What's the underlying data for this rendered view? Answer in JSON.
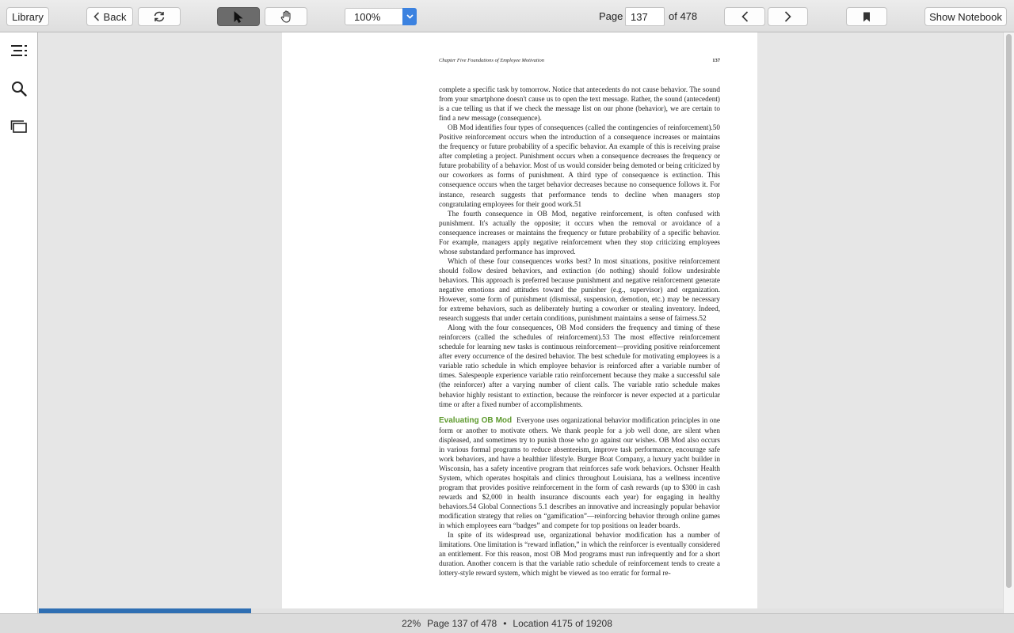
{
  "toolbar": {
    "library": "Library",
    "back": "Back",
    "zoom": "100%",
    "page_prefix": "Page",
    "page_value": "137",
    "page_suffix": "of 478",
    "show_notebook": "Show Notebook"
  },
  "book": {
    "running_head": "Chapter Five   Foundations of Employee Motivation",
    "page_number": "137",
    "section_heading": "Evaluating OB Mod",
    "paragraphs": [
      "complete a specific task by tomorrow. Notice that antecedents do not cause behavior. The sound from your smartphone doesn't cause us to open the text message. Rather, the sound (antecedent) is a cue telling us that if we check the message list on our phone (behavior), we are certain to find a new message (consequence).",
      "OB Mod identifies four types of consequences (called the contingencies of reinforcement).50 Positive reinforcement occurs when the introduction of a consequence increases or maintains the frequency or future probability of a specific behavior. An example of this is receiving praise after completing a project. Punishment occurs when a consequence decreases the frequency or future probability of a behavior. Most of us would consider being demoted or being criticized by our coworkers as forms of punishment. A third type of consequence is extinction. This consequence occurs when the target behavior decreases because no consequence follows it. For instance, research suggests that performance tends to decline when managers stop congratulating employees for their good work.51",
      "The fourth consequence in OB Mod, negative reinforcement, is often confused with punishment. It's actually the opposite; it occurs when the removal or avoidance of a consequence increases or maintains the frequency or future probability of a specific behavior. For example, managers apply negative reinforcement when they stop criticizing employees whose substandard performance has improved.",
      "Which of these four consequences works best? In most situations, positive reinforcement should follow desired behaviors, and extinction (do nothing) should follow undesirable behaviors. This approach is preferred because punishment and negative reinforcement generate negative emotions and attitudes toward the punisher (e.g., supervisor) and organization. However, some form of punishment (dismissal, suspension, demotion, etc.) may be necessary for extreme behaviors, such as deliberately hurting a coworker or stealing inventory. Indeed, research suggests that under certain conditions, punishment maintains a sense of fairness.52",
      "Along with the four consequences, OB Mod considers the frequency and timing of these reinforcers (called the schedules of reinforcement).53 The most effective reinforcement schedule for learning new tasks is continuous reinforcement—providing positive reinforcement after every occurrence of the desired behavior. The best schedule for motivating employees is a variable ratio schedule in which employee behavior is reinforced after a variable number of times. Salespeople experience variable ratio reinforcement because they make a successful sale (the reinforcer) after a varying number of client calls. The variable ratio schedule makes behavior highly resistant to extinction, because the reinforcer is never expected at a particular time or after a fixed number of accomplishments.",
      "Everyone uses organizational behavior modification principles in one form or another to motivate others. We thank people for a job well done, are silent when displeased, and sometimes try to punish those who go against our wishes. OB Mod also occurs in various formal programs to reduce absenteeism, improve task performance, encourage safe work behaviors, and have a healthier lifestyle. Burger Boat Company, a luxury yacht builder in Wisconsin, has a safety incentive program that reinforces safe work behaviors. Ochsner Health System, which operates hospitals and clinics throughout Louisiana, has a wellness incentive program that provides positive reinforcement in the form of cash rewards (up to $300 in cash rewards and $2,000 in health insurance discounts each year) for engaging in healthy behaviors.54 Global Connections 5.1 describes an innovative and increasingly popular behavior modification strategy that relies on “gamification”—reinforcing behavior through online games in which employees earn “badges” and compete for top positions on leader boards.",
      "In spite of its widespread use, organizational behavior modification has a number of limitations. One limitation is “reward inflation,” in which the reinforcer is eventually considered an entitlement. For this reason, most OB Mod programs must run infrequently and for a short duration. Another concern is that the variable ratio schedule of reinforcement tends to create a lottery-style reward system, which might be viewed as too erratic for formal re-"
    ]
  },
  "reading_progress": 0.22,
  "status": {
    "percent": "22%",
    "page": "Page 137 of 478",
    "separator": "•",
    "location": "Location 4175 of 19208"
  },
  "icons": {
    "toc": "toc-icon",
    "search": "search-icon",
    "flashcards": "flashcards-icon"
  },
  "colors": {
    "accent": "#3b82e0",
    "progress": "#2f6fb3",
    "section_heading": "#5e9a2e"
  }
}
